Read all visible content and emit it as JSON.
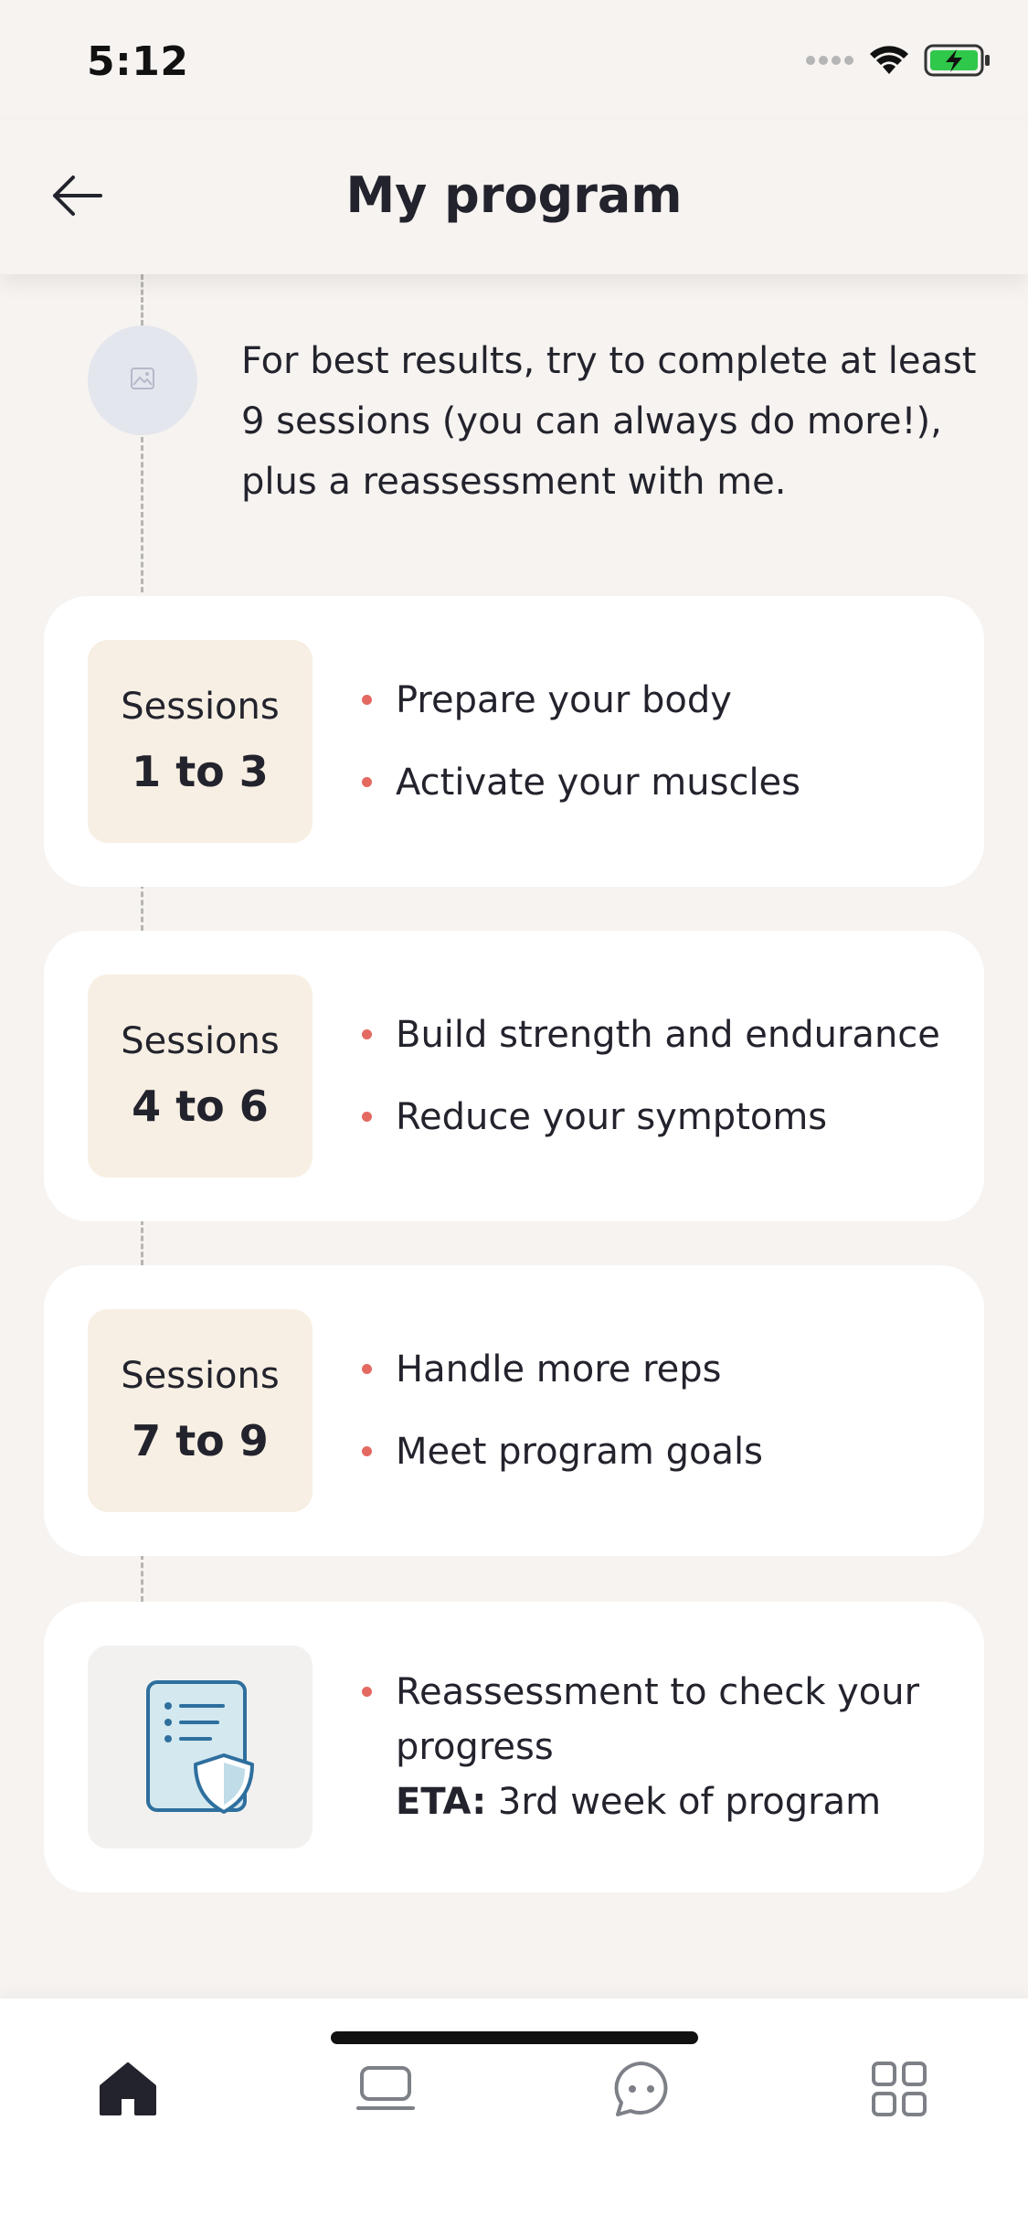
{
  "status_bar": {
    "time": "5:12",
    "signal_icon": "signal-dots-icon",
    "wifi_icon": "wifi-icon",
    "battery_icon": "battery-charging-icon",
    "battery_color": "#2FC84A"
  },
  "header": {
    "title": "My program",
    "back_icon": "arrow-left-icon"
  },
  "intro": {
    "avatar_icon": "image-placeholder-icon",
    "text": "For best results, try to complete at least 9 sessions (you can always do more!), plus a reassessment with me."
  },
  "program": {
    "stages": [
      {
        "label": "Sessions",
        "range": "1 to 3",
        "bullets": [
          "Prepare your body",
          "Activate your muscles"
        ]
      },
      {
        "label": "Sessions",
        "range": "4 to 6",
        "bullets": [
          "Build strength and endurance",
          "Reduce your symptoms"
        ]
      },
      {
        "label": "Sessions",
        "range": "7 to 9",
        "bullets": [
          "Handle more reps",
          "Meet program goals"
        ]
      }
    ],
    "reassessment": {
      "icon": "clipboard-shield-icon",
      "text": "Reassessment to check your progress",
      "eta_label": "ETA:",
      "eta_value": " 3rd week of program"
    }
  },
  "bottom_nav": {
    "items": [
      {
        "name": "home",
        "icon": "home-icon",
        "active": true
      },
      {
        "name": "sessions",
        "icon": "laptop-icon",
        "active": false
      },
      {
        "name": "chat",
        "icon": "chat-bubble-icon",
        "active": false
      },
      {
        "name": "more",
        "icon": "grid-icon",
        "active": false
      }
    ]
  },
  "colors": {
    "background": "#F6F3F0",
    "card": "#FFFFFF",
    "session_box": "#F7EFE3",
    "bullet_dot": "#E46A61",
    "text": "#23232D",
    "nav_inactive": "#7E8087",
    "nav_active": "#23232D"
  }
}
